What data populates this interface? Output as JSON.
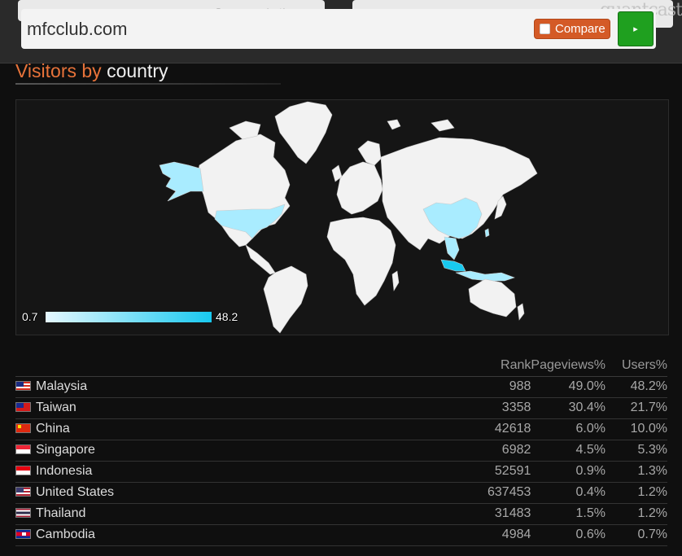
{
  "background": {
    "source_note": "Source: majestic.com",
    "brand": "quantcast"
  },
  "url_bar": {
    "domain": "mfcclub.com",
    "compare_label": "Compare",
    "go_label": "▸"
  },
  "section": {
    "title_accent": "Visitors by",
    "title_rest": "country"
  },
  "map": {
    "legend_min": "0.7",
    "legend_max": "48.2",
    "highlight_color": "#a9ecff",
    "land_color": "#f2f2f2",
    "ocean_color": "#151515",
    "scale": [
      0.7,
      48.2
    ]
  },
  "table": {
    "headers": {
      "rank": "Rank",
      "pageviews": "Pageviews%",
      "users": "Users%"
    },
    "rows": [
      {
        "country": "Malaysia",
        "flag": "my",
        "rank": "988",
        "pageviews": "49.0%",
        "users": "48.2%"
      },
      {
        "country": "Taiwan",
        "flag": "tw",
        "rank": "3358",
        "pageviews": "30.4%",
        "users": "21.7%"
      },
      {
        "country": "China",
        "flag": "cn",
        "rank": "42618",
        "pageviews": "6.0%",
        "users": "10.0%"
      },
      {
        "country": "Singapore",
        "flag": "sg",
        "rank": "6982",
        "pageviews": "4.5%",
        "users": "5.3%"
      },
      {
        "country": "Indonesia",
        "flag": "id",
        "rank": "52591",
        "pageviews": "0.9%",
        "users": "1.3%"
      },
      {
        "country": "United States",
        "flag": "us",
        "rank": "637453",
        "pageviews": "0.4%",
        "users": "1.2%"
      },
      {
        "country": "Thailand",
        "flag": "th",
        "rank": "31483",
        "pageviews": "1.5%",
        "users": "1.2%"
      },
      {
        "country": "Cambodia",
        "flag": "kh",
        "rank": "4984",
        "pageviews": "0.6%",
        "users": "0.7%"
      }
    ]
  }
}
